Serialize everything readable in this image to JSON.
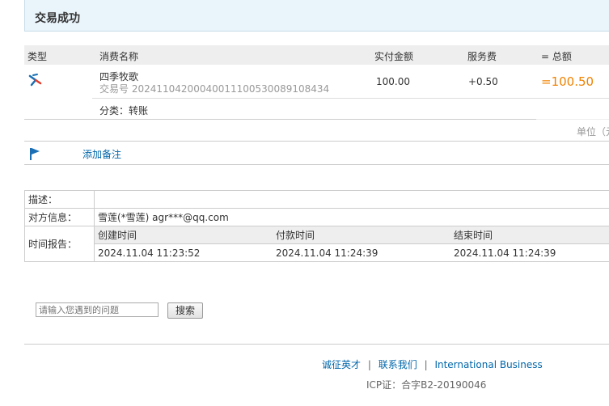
{
  "header": {
    "title": "交易成功"
  },
  "table": {
    "columns": {
      "type": "类型",
      "name": "消费名称",
      "paid": "实付金额",
      "fee": "服务费",
      "total": "= 总额"
    },
    "row": {
      "icon": "transfer-icon",
      "name": "四季牧歌",
      "trade_no_label": "交易号",
      "trade_no": "20241104200040011100530089108434",
      "paid": "100.00",
      "fee": "+0.50",
      "total": "=100.50",
      "category_label": "分类：",
      "category": "转账"
    },
    "unit_note": "单位（元）"
  },
  "remark": {
    "icon": "flag-icon",
    "link": "添加备注"
  },
  "details": {
    "description_label": "描述：",
    "description": "",
    "counterparty_label": "对方信息：",
    "counterparty": "雪莲(*雪莲) agr***@qq.com",
    "time_label": "时间报告：",
    "time_headers": [
      "创建时间",
      "付款时间",
      "结束时间"
    ],
    "time_values": [
      "2024.11.04 11:23:52",
      "2024.11.04 11:24:39",
      "2024.11.04 11:24:39"
    ]
  },
  "search": {
    "placeholder": "请输入您遇到的问题",
    "button": "搜索"
  },
  "footer": {
    "links": [
      "诚征英才",
      "联系我们",
      "International Business"
    ],
    "separator": "|",
    "icp": "ICP证：合字B2-20190046"
  },
  "colors": {
    "accent": "#f08200",
    "link": "#0066aa",
    "title_bg": "#eaf4fb"
  }
}
